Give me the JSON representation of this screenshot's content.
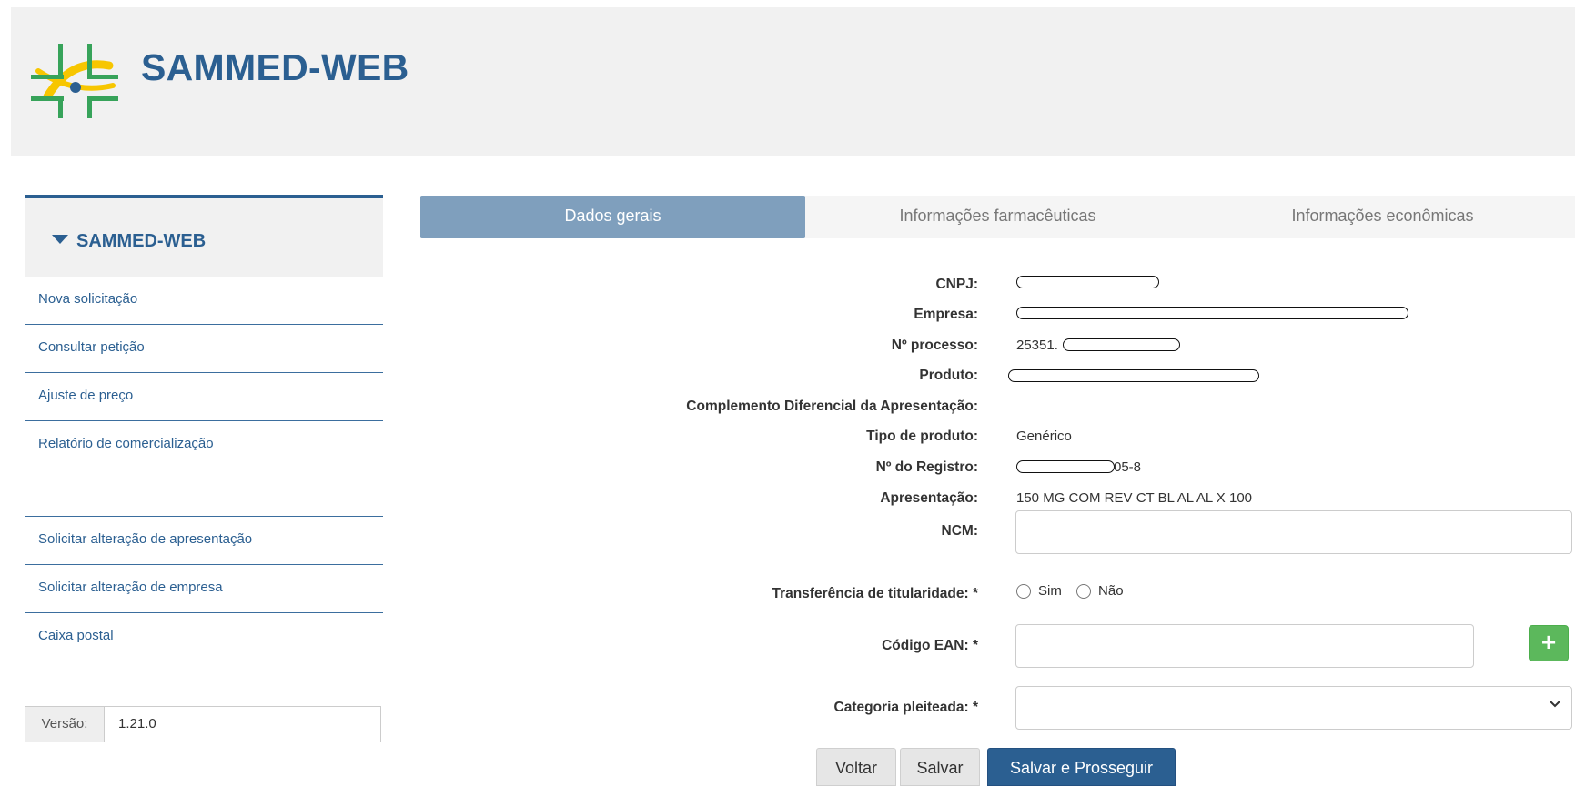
{
  "header": {
    "title": "SAMMED-WEB"
  },
  "sidebar": {
    "title": "SAMMED-WEB",
    "items": [
      {
        "label": "Nova solicitação"
      },
      {
        "label": "Consultar petição"
      },
      {
        "label": "Ajuste de preço"
      },
      {
        "label": "Relatório de comercialização"
      },
      {
        "label": ""
      },
      {
        "label": "Solicitar alteração de apresentação"
      },
      {
        "label": "Solicitar alteração de empresa"
      },
      {
        "label": "Caixa postal"
      }
    ],
    "version_label": "Versão:",
    "version_value": "1.21.0"
  },
  "tabs": [
    {
      "label": "Dados gerais",
      "active": true
    },
    {
      "label": "Informações farmacêuticas",
      "active": false
    },
    {
      "label": "Informações econômicas",
      "active": false
    }
  ],
  "form": {
    "cnpj_label": "CNPJ:",
    "empresa_label": "Empresa:",
    "processo_label": "Nº processo:",
    "processo_prefix": "25351.",
    "produto_label": "Produto:",
    "complemento_label": "Complemento Diferencial da Apresentação:",
    "tipo_label": "Tipo de produto:",
    "tipo_value": "Genérico",
    "registro_label": "Nº do Registro:",
    "registro_suffix": "05-8",
    "apresentacao_label": "Apresentação:",
    "apresentacao_value": "150 MG COM REV CT BL AL AL X 100",
    "ncm_label": "NCM:",
    "ncm_value": "",
    "transferencia_label": "Transferência de titularidade: *",
    "transferencia_options": [
      "Sim",
      "Não"
    ],
    "ean_label": "Código EAN: *",
    "ean_value": "",
    "add_ean_label": "+",
    "categoria_label": "Categoria pleiteada: *",
    "categoria_value": ""
  },
  "buttons": {
    "back": "Voltar",
    "save": "Salvar",
    "save_continue": "Salvar e Prosseguir"
  },
  "colors": {
    "brand_blue": "#2b5f91",
    "tab_active": "#7f9fbd",
    "success_green": "#5cb85c",
    "header_bg": "#f1f1f1"
  },
  "icons": {
    "logo": "sammed-cross-logo-icon",
    "sidebar_caret": "caret-down-icon",
    "select": "chevron-down-icon"
  }
}
